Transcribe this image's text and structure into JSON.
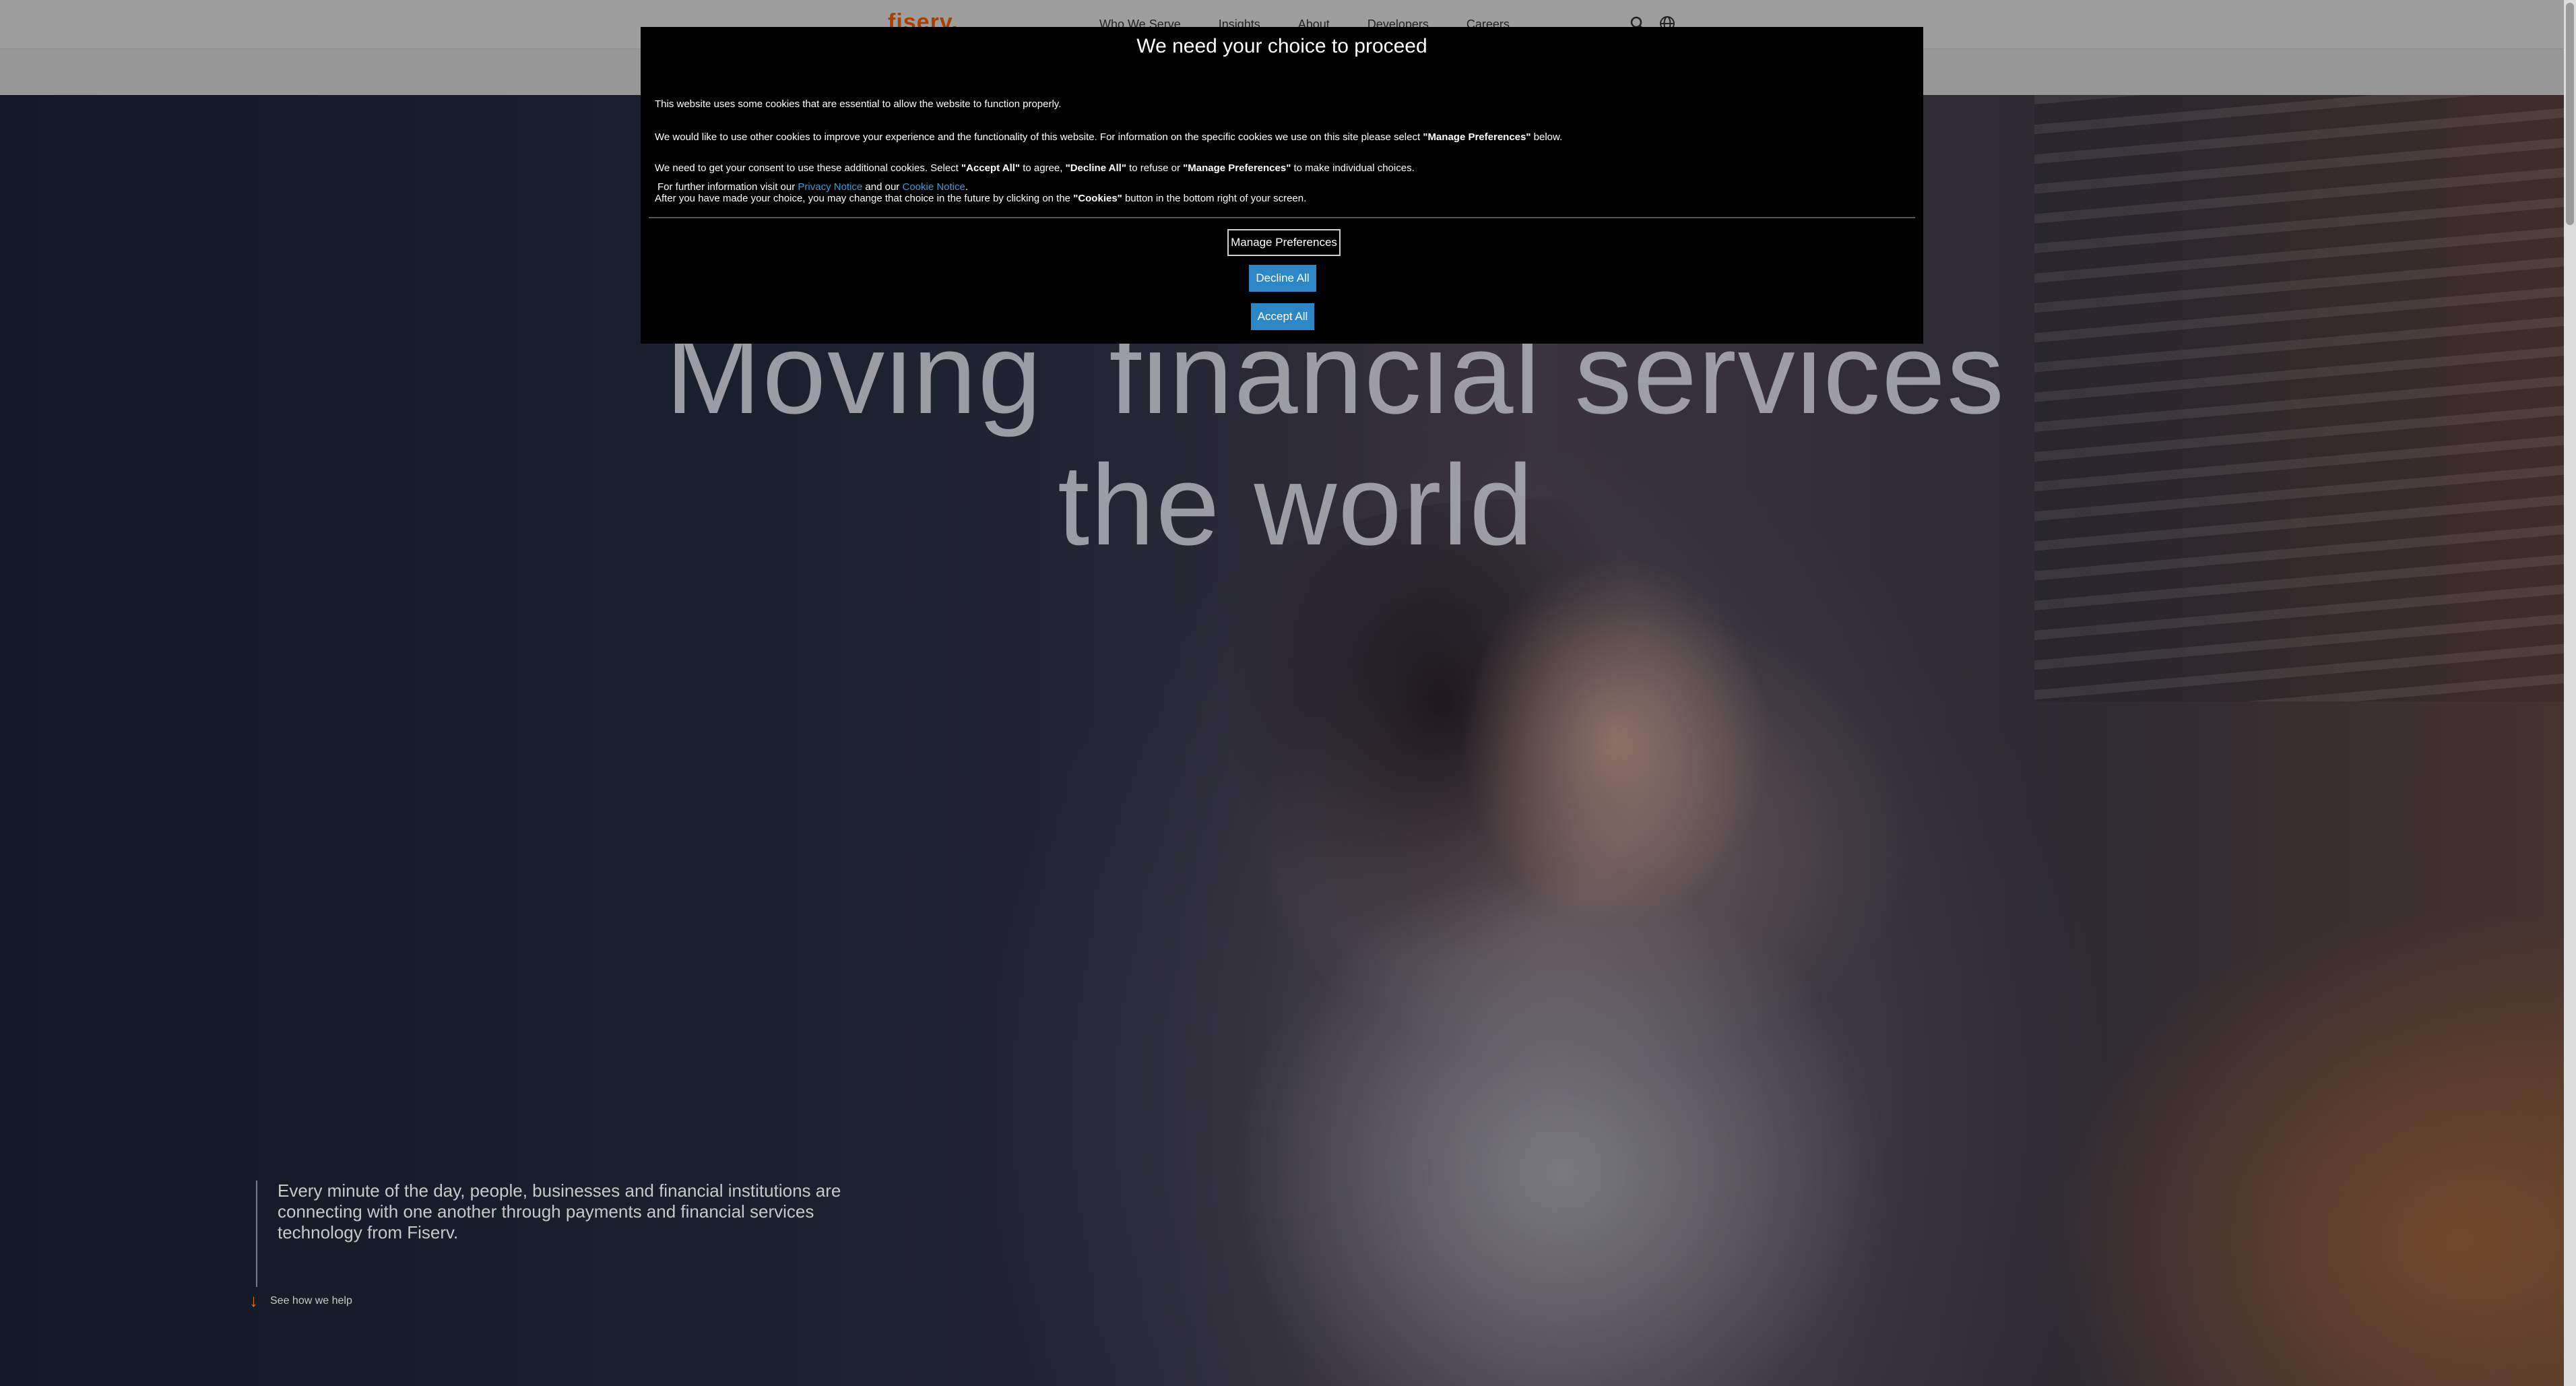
{
  "header": {
    "logo": "fiserv.",
    "nav": [
      "Who We Serve",
      "Insights",
      "About",
      "Developers",
      "Careers"
    ],
    "icons": [
      "search-icon",
      "globe-icon"
    ]
  },
  "hero": {
    "headline_line1": "Moving  financial services",
    "headline_line2": "the world",
    "intro": "Every minute of the day, people, businesses and financial institutions are connecting with one another through payments and financial services technology from Fiserv.",
    "cta": "See how we help"
  },
  "cookie_modal": {
    "title": "We need your choice to proceed",
    "p1": "This website uses some cookies that are essential to allow the website to function properly.",
    "p2_a": "We would like to use other cookies to improve your experience and the functionality of this website. For information on the specific cookies we use on this site please select ",
    "p2_b": "\"Manage Preferences\"",
    "p2_c": " below.",
    "p3_a": "We need to get your consent to use these additional cookies. Select ",
    "p3_b": "\"Accept All\"",
    "p3_c": " to agree, ",
    "p3_d": "\"Decline All\"",
    "p3_e": " to refuse or ",
    "p3_f": "\"Manage Preferences\"",
    "p3_g": " to make individual choices.",
    "p4_a": "After you have made your choice, you may change that choice in the future by clicking on the ",
    "p4_b": "\"Cookies\"",
    "p4_c": " button in the bottom right of your screen.",
    "further_a": "For further information visit our ",
    "privacy_link": "Privacy Notice",
    "further_b": " and our ",
    "cookie_link": "Cookie Notice",
    "further_c": ".",
    "buttons": {
      "manage": "Manage Preferences",
      "decline": "Decline All",
      "accept": "Accept All"
    }
  },
  "colors": {
    "brand": "#ff6600",
    "button": "#2d86c5",
    "link": "#3a9ad9"
  }
}
